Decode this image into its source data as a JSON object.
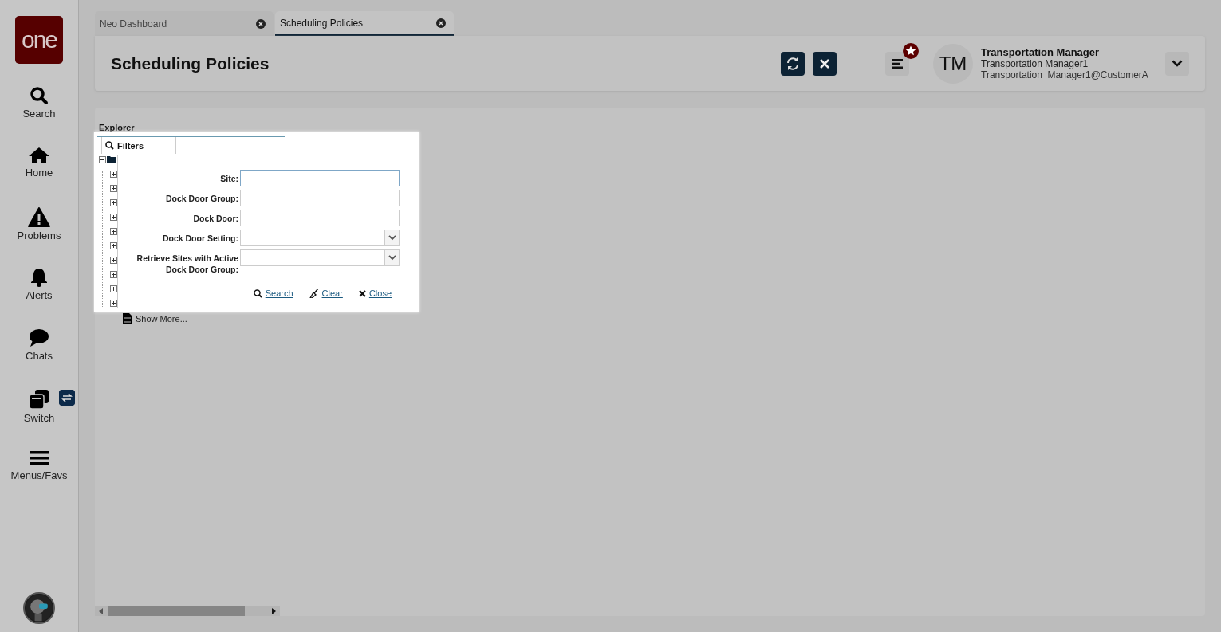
{
  "sidebar": {
    "logo": "one",
    "items": [
      {
        "kind": "search",
        "label": "Search"
      },
      {
        "kind": "home",
        "label": "Home"
      },
      {
        "kind": "problems",
        "label": "Problems"
      },
      {
        "kind": "alerts",
        "label": "Alerts"
      },
      {
        "kind": "chats",
        "label": "Chats"
      },
      {
        "kind": "switch",
        "label": "Switch"
      },
      {
        "kind": "menus",
        "label": "Menus/Favs"
      }
    ]
  },
  "tabs": [
    {
      "label": "Neo Dashboard",
      "selected": false
    },
    {
      "label": "Scheduling Policies",
      "selected": true
    }
  ],
  "header": {
    "title": "Scheduling Policies",
    "user": {
      "initials": "TM",
      "name": "Transportation Manager",
      "role": "Transportation Manager1",
      "login": "Transportation_Manager1@CustomerA"
    }
  },
  "explorer": {
    "title": "Explorer",
    "root": {
      "expanded": true,
      "children": [
        {
          "expanded": false
        },
        {
          "expanded": false
        },
        {
          "expanded": false
        },
        {
          "expanded": false
        },
        {
          "expanded": false
        },
        {
          "expanded": false
        },
        {
          "expanded": false
        },
        {
          "expanded": false
        },
        {
          "expanded": false
        },
        {
          "expanded": false
        }
      ]
    },
    "show_more": "Show More..."
  },
  "filter_panel": {
    "tab": "Filters",
    "fields": [
      {
        "label": "Site:",
        "kind": "text",
        "focused": true
      },
      {
        "label": "Dock Door Group:",
        "kind": "text",
        "focused": false
      },
      {
        "label": "Dock Door:",
        "kind": "text",
        "focused": false
      },
      {
        "label": "Dock Door Setting:",
        "kind": "select",
        "focused": false
      },
      {
        "label": "Retrieve Sites with Active Dock Door Group:",
        "kind": "select",
        "focused": false
      }
    ],
    "actions": [
      {
        "kind": "search",
        "label": "Search"
      },
      {
        "kind": "clear",
        "label": "Clear"
      },
      {
        "kind": "close",
        "label": "Close"
      }
    ]
  }
}
